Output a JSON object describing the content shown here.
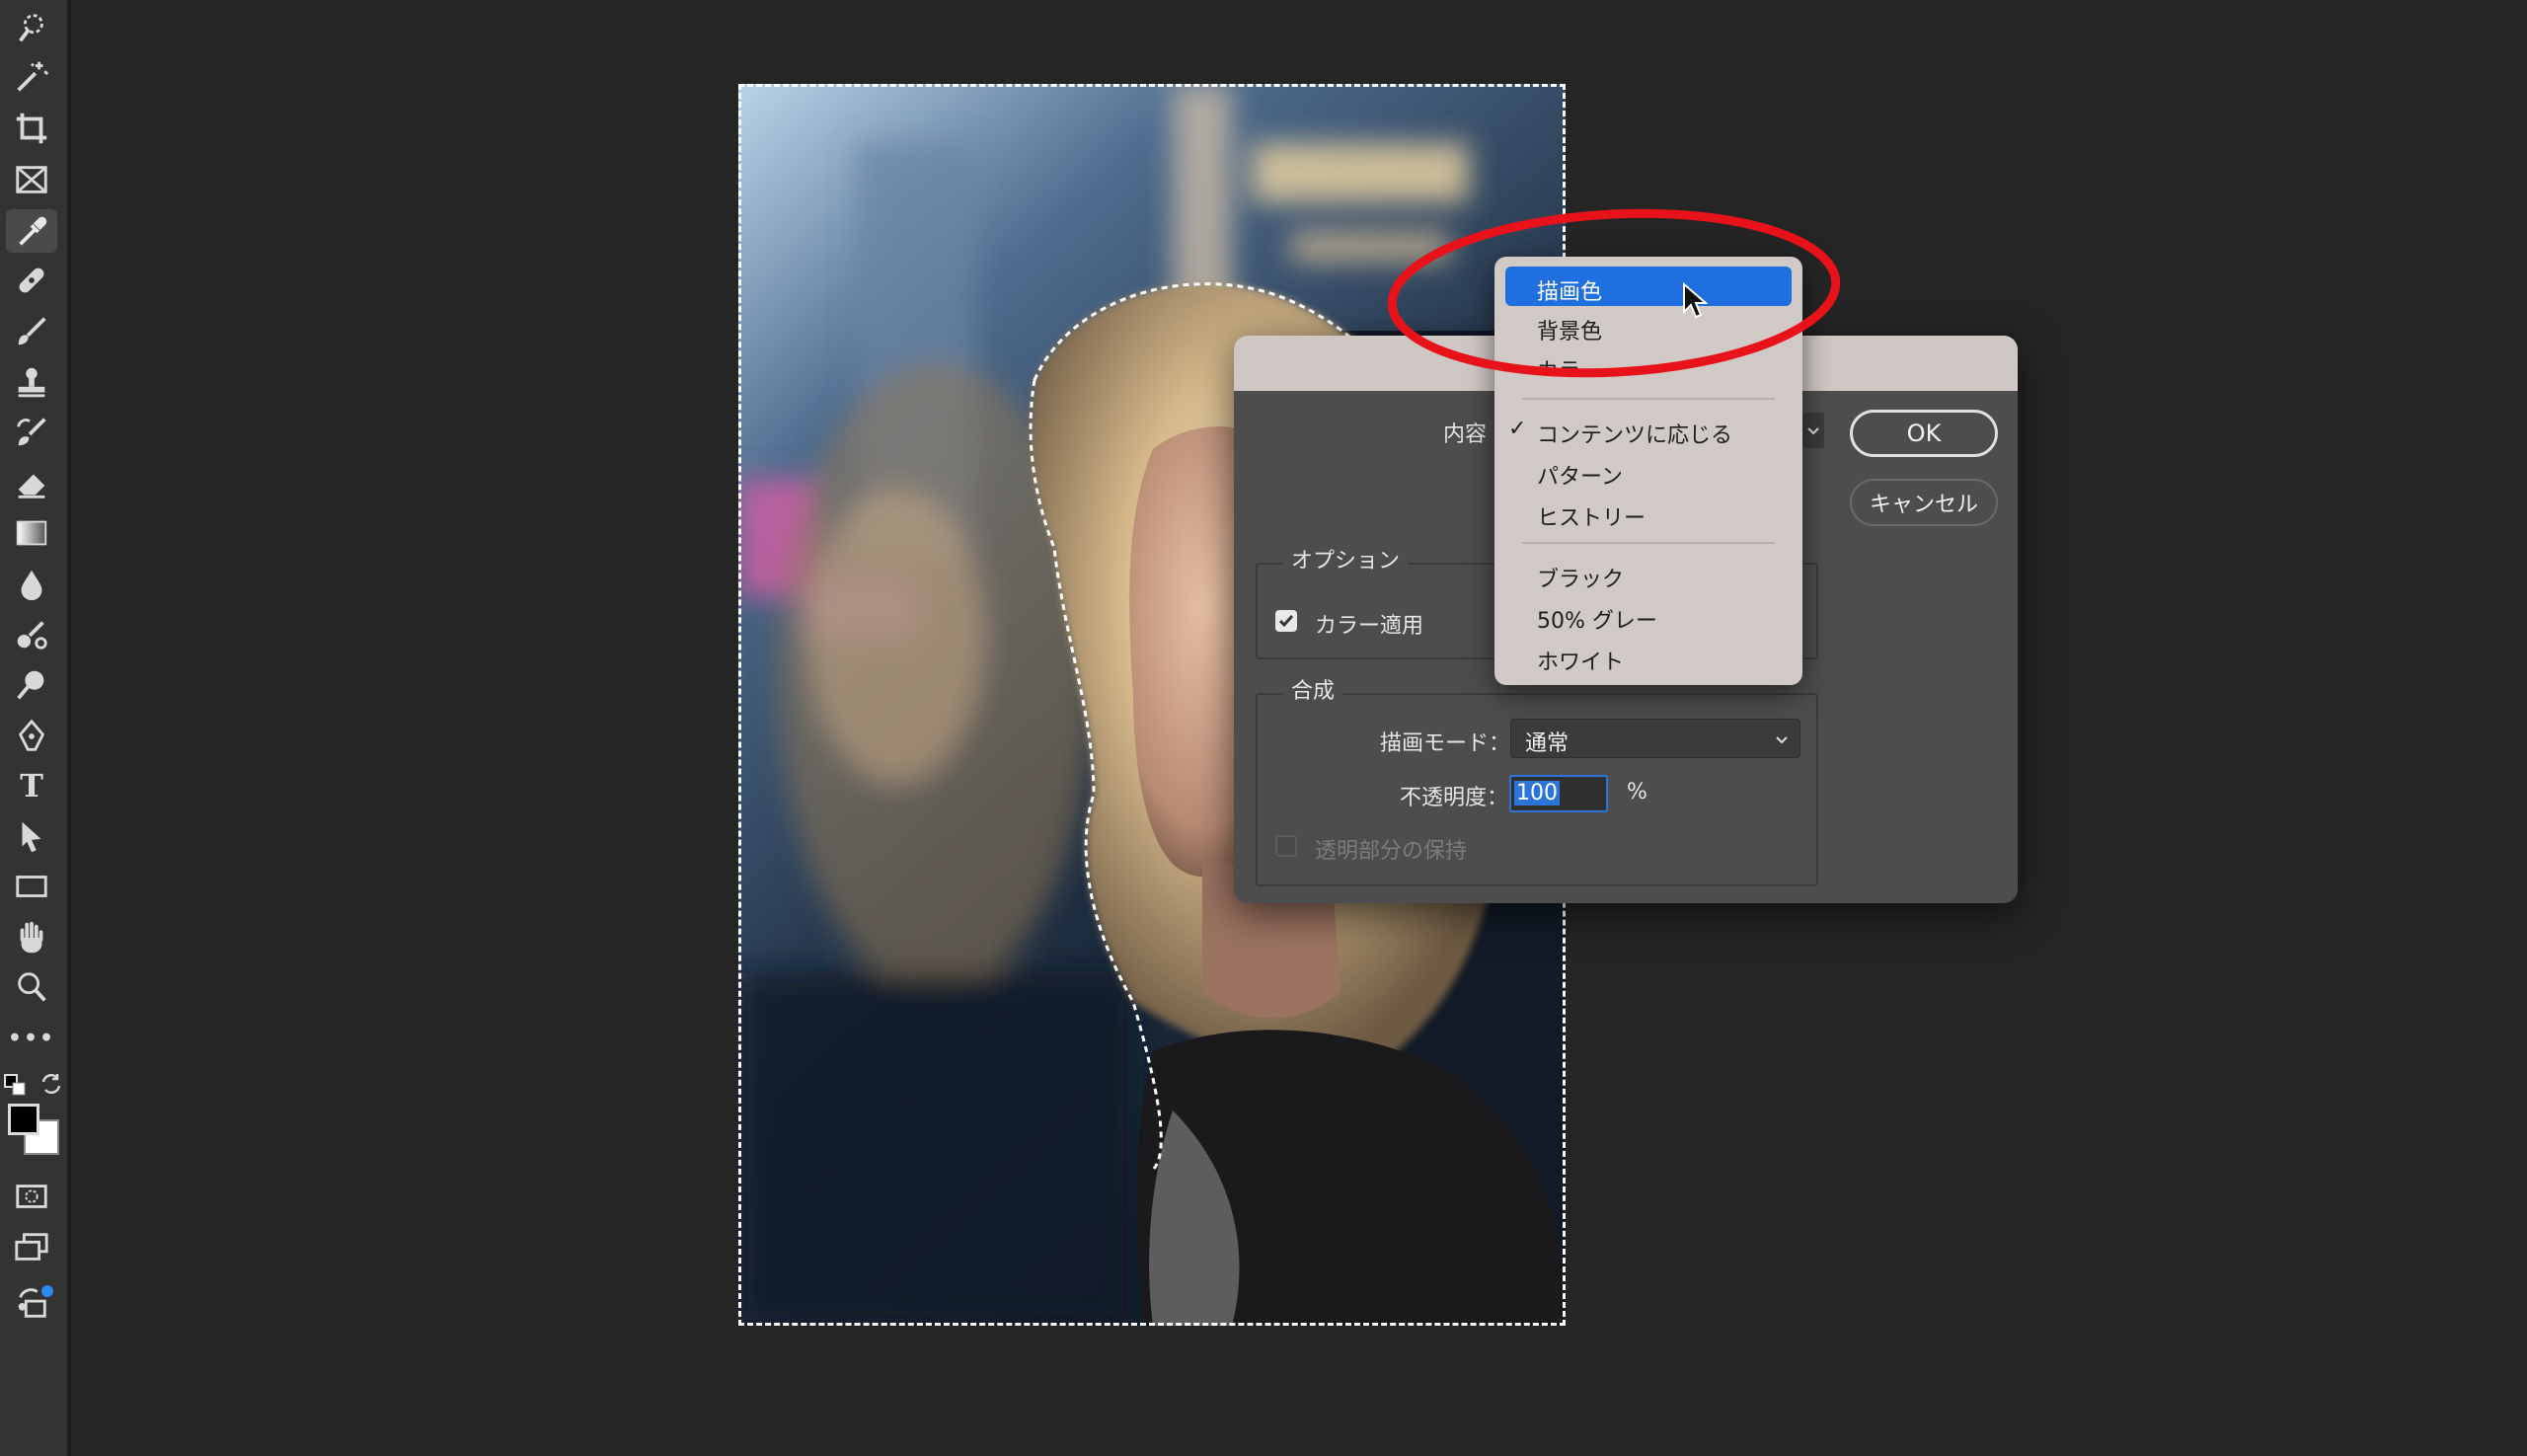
{
  "toolbar": {
    "tools": [
      "quick-selection",
      "magic-wand",
      "crop",
      "frame",
      "eyedropper",
      "spot-healing",
      "brush",
      "clone-stamp",
      "history-brush",
      "eraser",
      "gradient",
      "blur",
      "dodge",
      "burn",
      "pen",
      "type",
      "path-selection",
      "rectangle",
      "hand",
      "zoom",
      "more"
    ],
    "active_tool": "eyedropper",
    "type_tool_glyph": "T",
    "more_glyph": "•••",
    "foreground_color": "#000000",
    "background_color": "#ffffff"
  },
  "fill_dialog": {
    "contents_label": "内容",
    "ok_label": "OK",
    "cancel_label": "キャンセル",
    "options_group_label": "オプション",
    "color_adapt_label": "カラー適用",
    "color_adapt_checked": true,
    "blending_group_label": "合成",
    "mode_label": "描画モード：",
    "mode_value": "通常",
    "opacity_label": "不透明度：",
    "opacity_value": "100",
    "opacity_unit": "%",
    "preserve_transparency_label": "透明部分の保持",
    "preserve_transparency_checked": false
  },
  "contents_menu": {
    "items": [
      {
        "label": "描画色",
        "highlighted": true
      },
      {
        "label": "背景色"
      },
      {
        "label": "カラー"
      },
      {
        "label": "コンテンツに応じる",
        "checked": true
      },
      {
        "label": "パターン"
      },
      {
        "label": "ヒストリー"
      },
      {
        "label": "ブラック"
      },
      {
        "label": "50% グレー"
      },
      {
        "label": "ホワイト"
      }
    ],
    "check_glyph": "✓"
  },
  "annotation": {
    "color": "#e8131a"
  },
  "colors": {
    "highlight": "#1f6fe0",
    "selection_border": "#2d74d8"
  }
}
